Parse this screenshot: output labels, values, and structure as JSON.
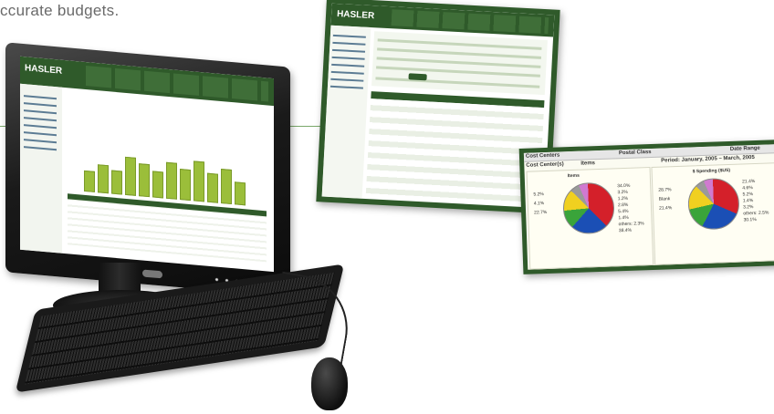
{
  "headline": "ccurate budgets.",
  "monitor": {
    "logo": "HASLER",
    "bar_values": [
      22,
      30,
      25,
      42,
      36,
      28,
      40,
      33,
      44,
      31,
      38,
      24
    ]
  },
  "window_report": {
    "logo": "HASLER"
  },
  "window_pies": {
    "tabs": {
      "left": "Cost Centers",
      "middle": "Postal Class",
      "right": "Date Range"
    },
    "headers": {
      "left": "Cost Center(s)",
      "middle": "Items",
      "right": "Period: January, 2005 – March, 2005"
    },
    "pies": [
      {
        "name": "Items",
        "slices": [
          {
            "color": "#d4202a",
            "value": 38
          },
          {
            "color": "#1b4fb5",
            "value": 24
          },
          {
            "color": "#3aa43a",
            "value": 12
          },
          {
            "color": "#f0d020",
            "value": 14
          },
          {
            "color": "#9a9a9a",
            "value": 6
          },
          {
            "color": "#d07ad0",
            "value": 6
          }
        ],
        "labels_left": [
          "5.2%",
          "4.1%",
          "22.7%"
        ],
        "labels_right": [
          "34.0%",
          "3.2%",
          "1.2%",
          "2.8%",
          "5.4%",
          "1.4%",
          "others: 2.3%",
          "38.4%"
        ]
      },
      {
        "name": "$ Spending ($US)",
        "slices": [
          {
            "color": "#d4202a",
            "value": 32
          },
          {
            "color": "#1b4fb5",
            "value": 26
          },
          {
            "color": "#3aa43a",
            "value": 14
          },
          {
            "color": "#f0d020",
            "value": 16
          },
          {
            "color": "#9a9a9a",
            "value": 6
          },
          {
            "color": "#d07ad0",
            "value": 6
          }
        ],
        "labels_left": [
          "28.7%",
          "Blank",
          "21.4%"
        ],
        "labels_right": [
          "21.4%",
          "4.6%",
          "5.2%",
          "1.4%",
          "3.2%",
          "others: 2.5%",
          "30.1%"
        ]
      }
    ]
  }
}
